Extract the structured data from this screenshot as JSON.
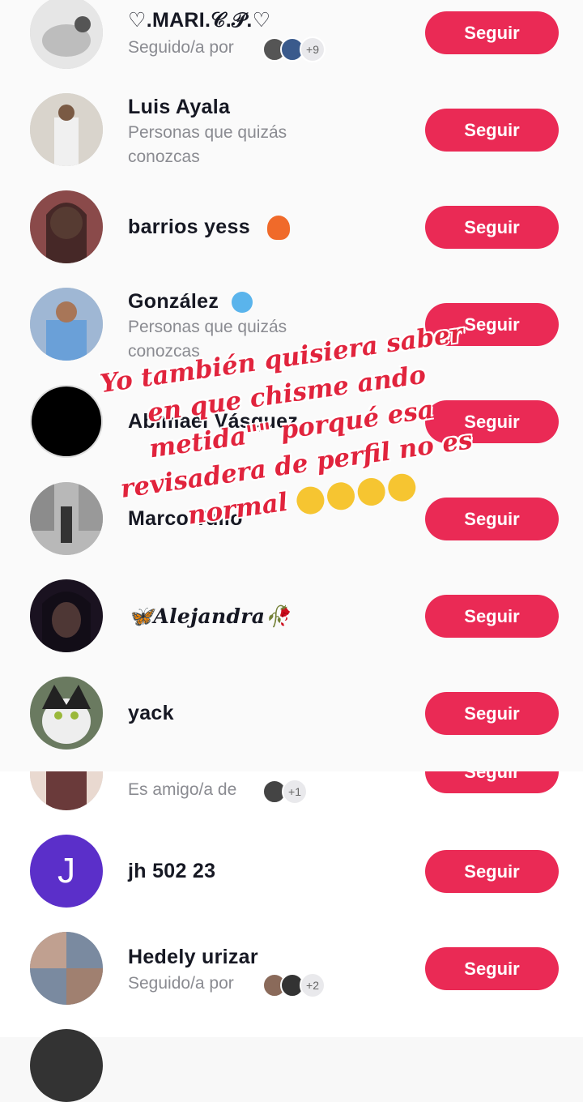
{
  "follow_label": "Seguir",
  "rows": [
    {
      "name": "♡.MARI.𝒞.𝒫.♡",
      "sub": "Seguido/a por",
      "more": "+9"
    },
    {
      "name": "Luis Ayala",
      "sub1": "Personas que quizás",
      "sub2": "conozcas"
    },
    {
      "name": "barrios yess"
    },
    {
      "name": "González",
      "sub1": "Personas que quizás",
      "sub2": "conozcas"
    },
    {
      "name": "Abimael Vásquez"
    },
    {
      "name": "Marco Tulio"
    },
    {
      "name": "🦋Alejandra🥀"
    },
    {
      "name": "yack"
    },
    {
      "sub": "Es amigo/a de",
      "more": "+1"
    },
    {
      "name": "jh 502 23",
      "initial": "J"
    },
    {
      "name": "Hedely urizar",
      "sub": "Seguido/a por",
      "more": "+2"
    }
  ],
  "overlay": {
    "line1": "Yo también quisiera saber",
    "line2": "en que chisme ando",
    "line3": "metida\"\" porqué esa",
    "line4": "revisadera de perfil no es",
    "line5": "normal"
  },
  "colors": {
    "accent": "#ea2a55",
    "overlay_text": "#e1243d"
  }
}
